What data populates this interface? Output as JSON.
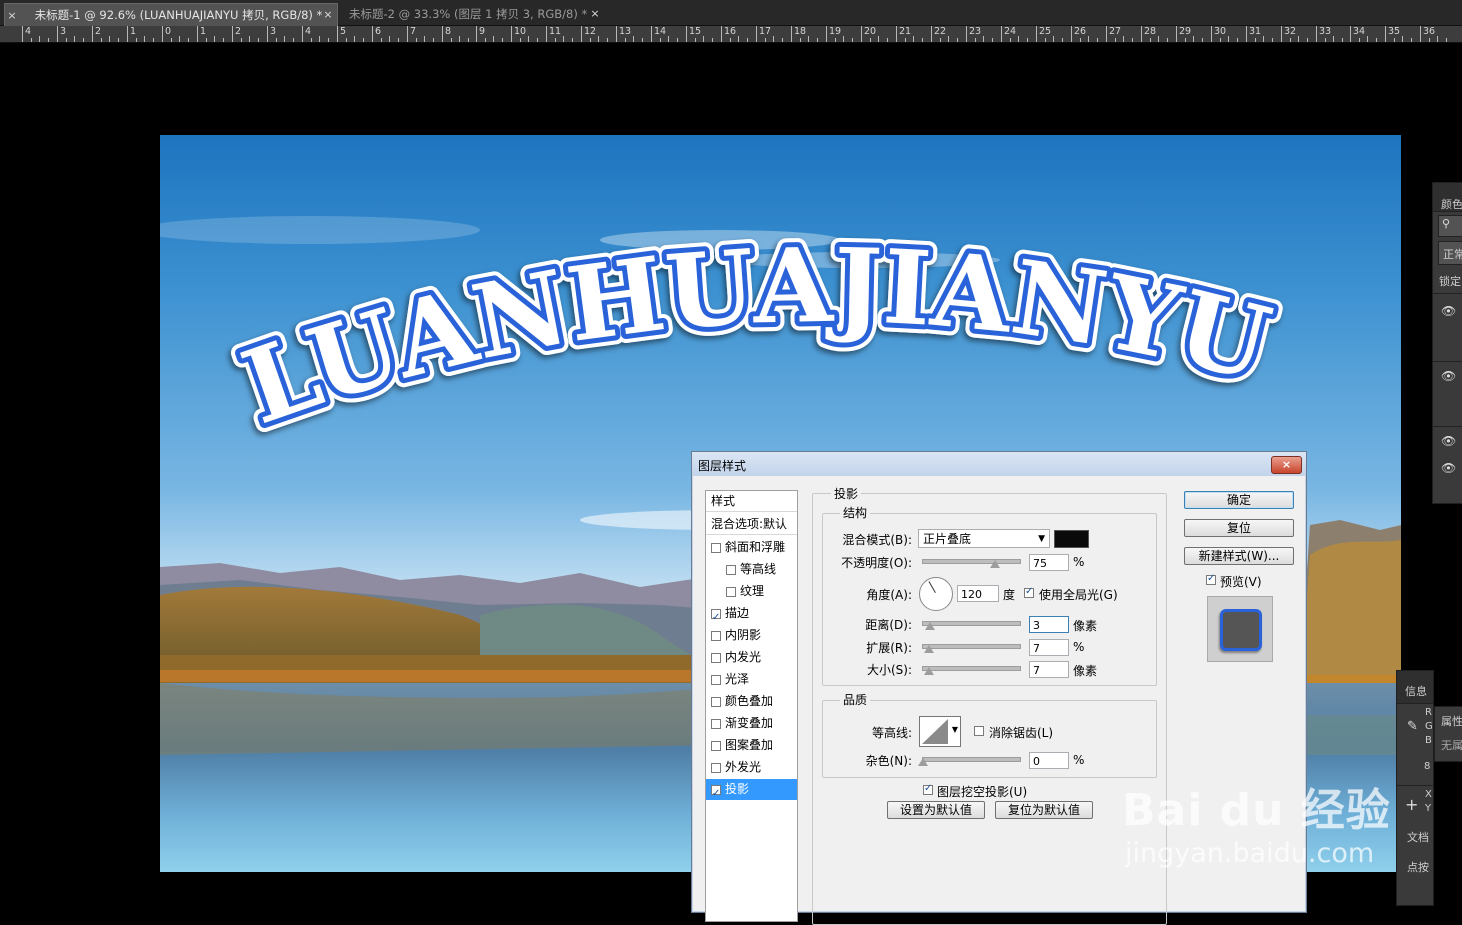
{
  "tabs": [
    {
      "label": "未标题-1 @ 92.6% (LUANHUAJIANYU 拷贝, RGB/8) *",
      "close": "×",
      "active": true
    },
    {
      "label": "未标题-2 @ 33.3% (图层 1 拷贝 3, RGB/8) *",
      "close": "×",
      "active": false
    }
  ],
  "ruler_numbers": [
    "4",
    "3",
    "2",
    "1",
    "0",
    "1",
    "2",
    "3",
    "4",
    "5",
    "6",
    "7",
    "8",
    "9",
    "10",
    "11",
    "12",
    "13",
    "14",
    "15",
    "16",
    "17",
    "18",
    "19",
    "20",
    "21",
    "22",
    "23",
    "24",
    "25",
    "26",
    "27",
    "28",
    "29",
    "30",
    "31",
    "32",
    "33",
    "34",
    "35",
    "36"
  ],
  "canvas": {
    "text": "LUANHUAJIANYU",
    "stroke_color": "#2a63d9",
    "fill_color": "#ffffff"
  },
  "right_panels": {
    "color_tab": "颜色",
    "search_icon": "search-icon",
    "blend_mode_short": "正常",
    "lock_label": "锁定",
    "info_tab": "信息",
    "props_tab": "属性",
    "props_value": "无属",
    "info_letters": [
      "R",
      "G",
      "B"
    ],
    "info_value": "8",
    "xy_letters": [
      "X",
      "Y"
    ],
    "doc_label": "文档",
    "hint_label": "点按"
  },
  "dialog": {
    "title": "图层样式",
    "close": "×",
    "styles_header": "样式",
    "blend_options": "混合选项:默认",
    "style_items": [
      {
        "label": "斜面和浮雕",
        "checked": false,
        "indent": false
      },
      {
        "label": "等高线",
        "checked": false,
        "indent": true
      },
      {
        "label": "纹理",
        "checked": false,
        "indent": true
      },
      {
        "label": "描边",
        "checked": true,
        "indent": false
      },
      {
        "label": "内阴影",
        "checked": false,
        "indent": false
      },
      {
        "label": "内发光",
        "checked": false,
        "indent": false
      },
      {
        "label": "光泽",
        "checked": false,
        "indent": false
      },
      {
        "label": "颜色叠加",
        "checked": false,
        "indent": false
      },
      {
        "label": "渐变叠加",
        "checked": false,
        "indent": false
      },
      {
        "label": "图案叠加",
        "checked": false,
        "indent": false
      },
      {
        "label": "外发光",
        "checked": false,
        "indent": false
      },
      {
        "label": "投影",
        "checked": true,
        "indent": false,
        "selected": true
      }
    ],
    "section_title": "投影",
    "structure_title": "结构",
    "blend_mode_label": "混合模式(B):",
    "blend_mode_value": "正片叠底",
    "shadow_color": "#0a0a0a",
    "opacity_label": "不透明度(O):",
    "opacity_value": "75",
    "opacity_unit": "%",
    "opacity_level": 0.75,
    "angle_label": "角度(A):",
    "angle_value": "120",
    "angle_unit": "度",
    "global_light_label": "使用全局光(G)",
    "global_light_checked": true,
    "distance_label": "距离(D):",
    "distance_value": "3",
    "distance_unit": "像素",
    "spread_label": "扩展(R):",
    "spread_value": "7",
    "spread_unit": "%",
    "size_label": "大小(S):",
    "size_value": "7",
    "size_unit": "像素",
    "quality_title": "品质",
    "contour_label": "等高线:",
    "anti_alias_label": "消除锯齿(L)",
    "noise_label": "杂色(N):",
    "noise_value": "0",
    "noise_unit": "%",
    "knockout_label": "图层挖空投影(U)",
    "knockout_checked": true,
    "set_default_button": "设置为默认值",
    "reset_default_button": "复位为默认值",
    "ok_button": "确定",
    "reset_button": "复位",
    "new_style_button": "新建样式(W)...",
    "preview_label": "预览(V)",
    "preview_checked": true
  },
  "watermark": {
    "logo": "Bai du 经验",
    "url": "jingyan.baidu.com"
  }
}
